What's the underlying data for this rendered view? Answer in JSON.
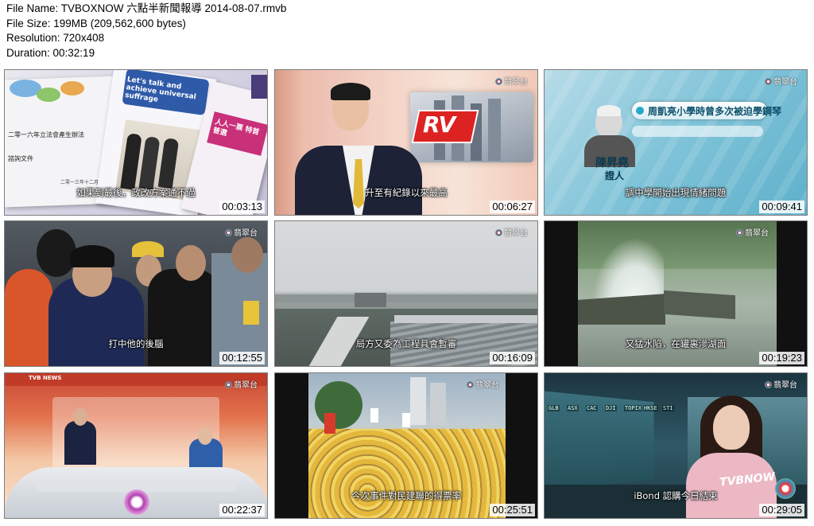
{
  "file_info": {
    "name_line": "File Name: TVBOXNOW 六點半新聞報導 2014-08-07.rmvb",
    "size_line": "File Size: 199MB (209,562,600 bytes)",
    "resolution_line": "Resolution: 720x408",
    "duration_line": "Duration: 00:32:19"
  },
  "thumbnails": [
    {
      "time": "00:03:13",
      "subtitle": "如果到最後，政改方案通不過",
      "logo": "",
      "book_text_1": "Let's talk and achieve universal suffrage",
      "book_text_2": "人人一票 特首普選",
      "book_text_3": "二零一六年立法會產生辦法",
      "book_text_4": "諮詢文件",
      "book_text_5": "二零一三年十二月"
    },
    {
      "time": "00:06:27",
      "subtitle": "升至有紀錄以來最高",
      "logo": "翡翠台",
      "graphic": "RV"
    },
    {
      "time": "00:09:41",
      "subtitle": "調中學開始出現情緒問題",
      "logo": "翡翠台",
      "headline": "周凱亮小學時曾多次被迫學鋼琴",
      "name": "陳昇堯",
      "role": "證人"
    },
    {
      "time": "00:12:55",
      "subtitle": "打中他的後腦",
      "logo": "翡翠台"
    },
    {
      "time": "00:16:09",
      "subtitle": "局方又委為工程具會暫審",
      "logo": "翡翠台"
    },
    {
      "time": "00:19:23",
      "subtitle": "又猛水陷，在罐裏滲湖面",
      "logo": "翡翠台"
    },
    {
      "time": "00:22:37",
      "subtitle": "",
      "logo": "翡翠台",
      "banner": "TVB NEWS"
    },
    {
      "time": "00:25:51",
      "subtitle": "今次事件對民建聯的得票率",
      "logo": "翡翠台"
    },
    {
      "time": "00:29:05",
      "subtitle": "iBond 認購今日結束",
      "logo": "翡翠台",
      "watermark": "TVBNOW",
      "tickers": [
        "GLB",
        "ASX",
        "CAC",
        "DJI",
        "TOPIX",
        "HKSE",
        "STI"
      ]
    }
  ]
}
